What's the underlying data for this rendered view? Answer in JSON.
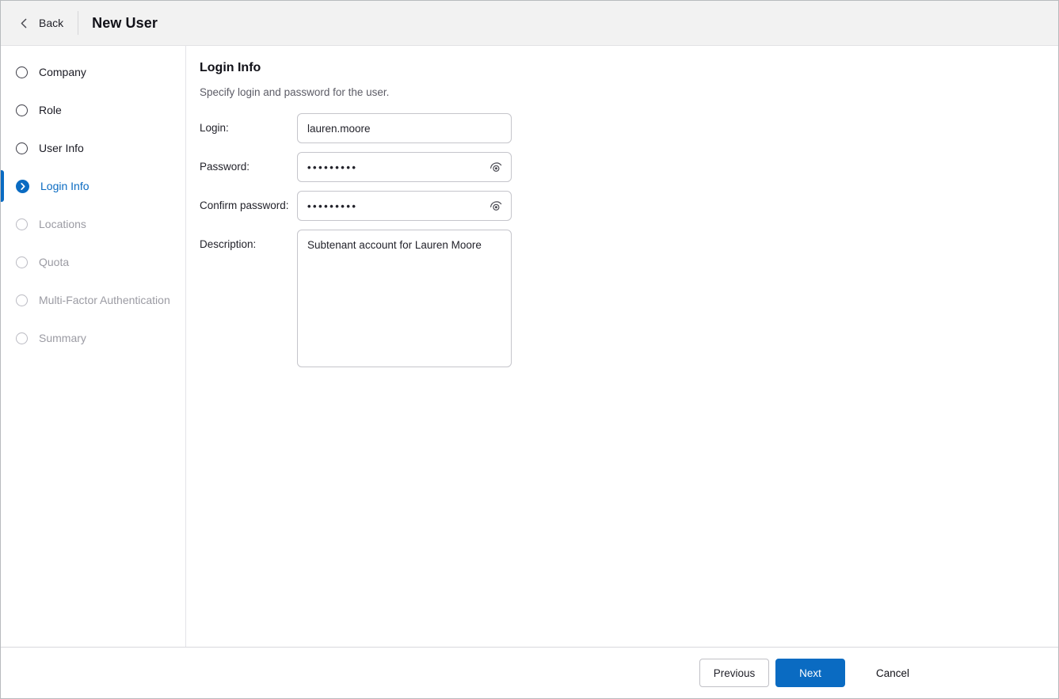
{
  "header": {
    "back_label": "Back",
    "title": "New User"
  },
  "wizard": {
    "steps": [
      {
        "label": "Company",
        "state": "done"
      },
      {
        "label": "Role",
        "state": "done"
      },
      {
        "label": "User Info",
        "state": "done"
      },
      {
        "label": "Login Info",
        "state": "active"
      },
      {
        "label": "Locations",
        "state": "upcoming"
      },
      {
        "label": "Quota",
        "state": "upcoming"
      },
      {
        "label": "Multi-Factor Authentication",
        "state": "upcoming"
      },
      {
        "label": "Summary",
        "state": "upcoming"
      }
    ]
  },
  "section": {
    "title": "Login Info",
    "subtitle": "Specify login and password for the user."
  },
  "form": {
    "login": {
      "label": "Login:",
      "value": "lauren.moore"
    },
    "password": {
      "label": "Password:",
      "value": "•••••••••"
    },
    "confirm_password": {
      "label": "Confirm password:",
      "value": "•••••••••"
    },
    "description": {
      "label": "Description:",
      "value": "Subtenant account for Lauren Moore"
    }
  },
  "footer": {
    "previous_label": "Previous",
    "next_label": "Next",
    "cancel_label": "Cancel"
  },
  "icons": {
    "back": "chevron-left-icon",
    "active_step": "chevron-right-circle-icon",
    "show_password": "eye-icon"
  },
  "colors": {
    "accent_blue": "#0a6bc2",
    "header_bg": "#f2f2f2",
    "border_gray": "#e4e4e8",
    "muted_text": "#9b9ba3",
    "dark_text": "#1b1b24"
  }
}
